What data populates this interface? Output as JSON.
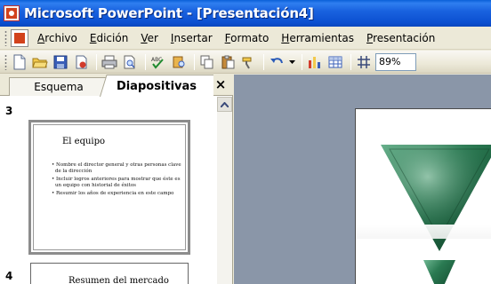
{
  "window": {
    "title": "Microsoft PowerPoint - [Presentación4]"
  },
  "menu": {
    "items": [
      {
        "pre": "",
        "acc": "A",
        "post": "rchivo"
      },
      {
        "pre": "",
        "acc": "E",
        "post": "dición"
      },
      {
        "pre": "",
        "acc": "V",
        "post": "er"
      },
      {
        "pre": "",
        "acc": "I",
        "post": "nsertar"
      },
      {
        "pre": "",
        "acc": "F",
        "post": "ormato"
      },
      {
        "pre": "",
        "acc": "H",
        "post": "erramientas"
      },
      {
        "pre": "",
        "acc": "P",
        "post": "resentación"
      }
    ]
  },
  "toolbar": {
    "zoom": "89%"
  },
  "panel": {
    "tab_outline": "Esquema",
    "tab_slides": "Diapositivas",
    "close_glyph": "×"
  },
  "thumbnails": [
    {
      "number": "3",
      "title": "El equipo",
      "bullets": [
        "Nombre el director general y otras personas clave de la dirección",
        "Incluir logros anteriores para mostrar que éste es un equipo con historial de éxitos",
        "Resumir los años de experiencia en este campo"
      ]
    },
    {
      "number": "4",
      "title": "Resumen del mercado"
    }
  ],
  "colors": {
    "title_bar": "#0b4fd0",
    "marble_green": "#1f6b47",
    "workspace": "#8a96a8"
  }
}
